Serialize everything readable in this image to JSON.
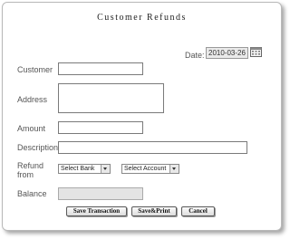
{
  "form": {
    "title": "Customer Refunds",
    "date_label": "Date:",
    "date_value": "2010-03-26",
    "customer_label": "Customer",
    "customer_value": "",
    "address_label": "Address",
    "address_value": "",
    "amount_label": "Amount",
    "amount_value": "",
    "description_label": "Description",
    "description_value": "",
    "refund_from_label_1": "Refund",
    "refund_from_label_2": "from",
    "bank_select": "Select Bank",
    "account_select": "Select Account",
    "balance_label": "Balance",
    "balance_value": ""
  },
  "buttons": {
    "save_transaction": "Save Transaction",
    "save_print": "Save&Print",
    "cancel": "Cancel"
  }
}
